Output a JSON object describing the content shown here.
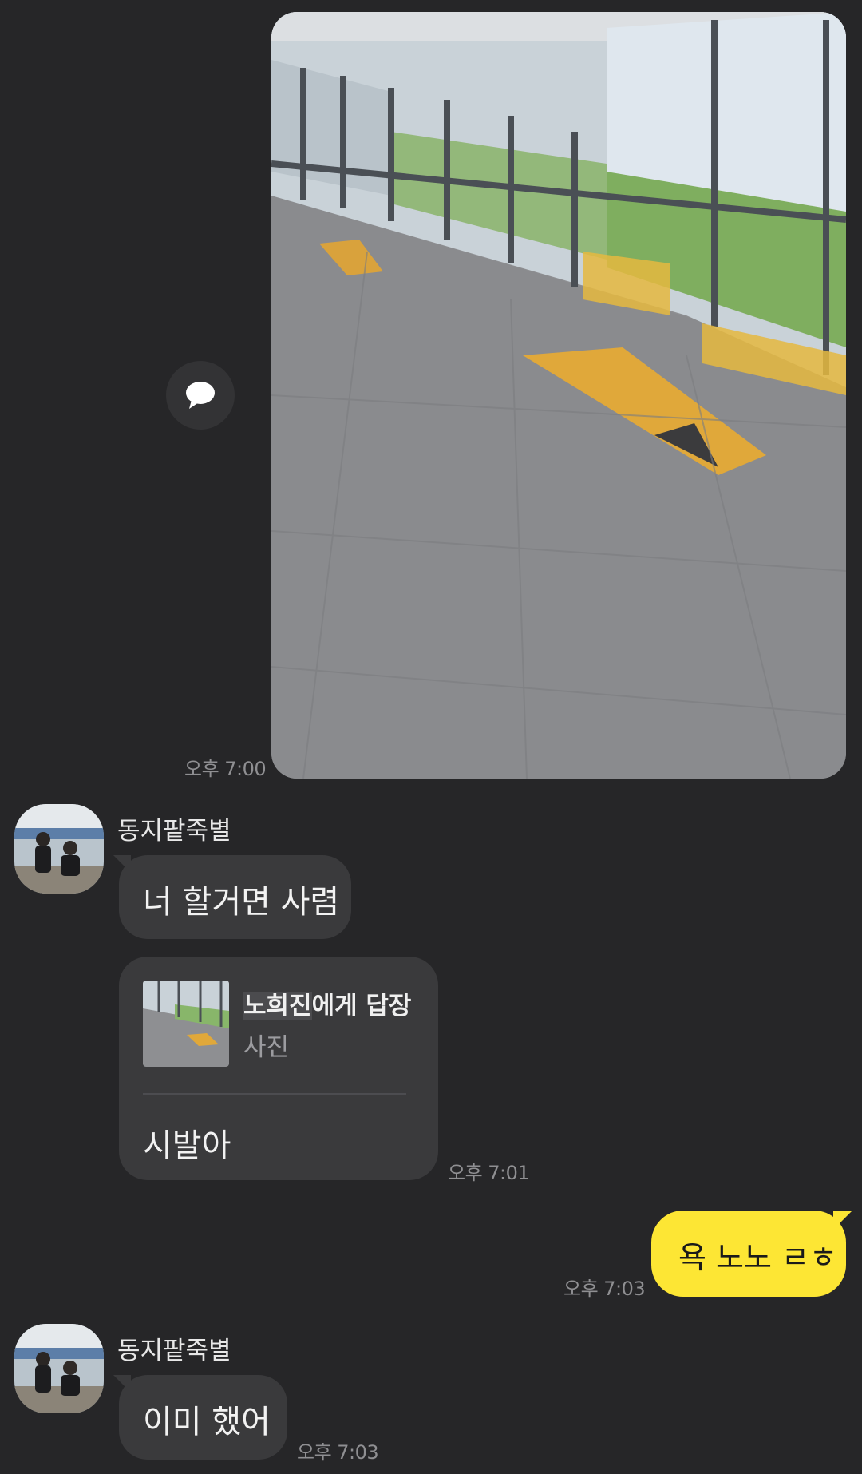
{
  "messages": {
    "photo_time": "오후 7:00",
    "sender_name_1": "동지팥죽별",
    "msg_1": "너 할거면 사렴",
    "reply_to_name": "노희진",
    "reply_to_suffix": "에게 답장",
    "reply_type": "사진",
    "reply_text": "시발아",
    "reply_time": "오후 7:01",
    "my_msg": "욕 노노 ㄹㅎ",
    "my_msg_time": "오후 7:03",
    "sender_name_2": "동지팥죽별",
    "msg_2": "이미 했어",
    "msg_2_time": "오후 7:03"
  },
  "icons": {
    "share": "speech-bubble-icon"
  },
  "colors": {
    "background": "#262628",
    "bubble_other": "#3a3a3c",
    "bubble_me": "#fde634",
    "time_text": "#8f8f92"
  }
}
